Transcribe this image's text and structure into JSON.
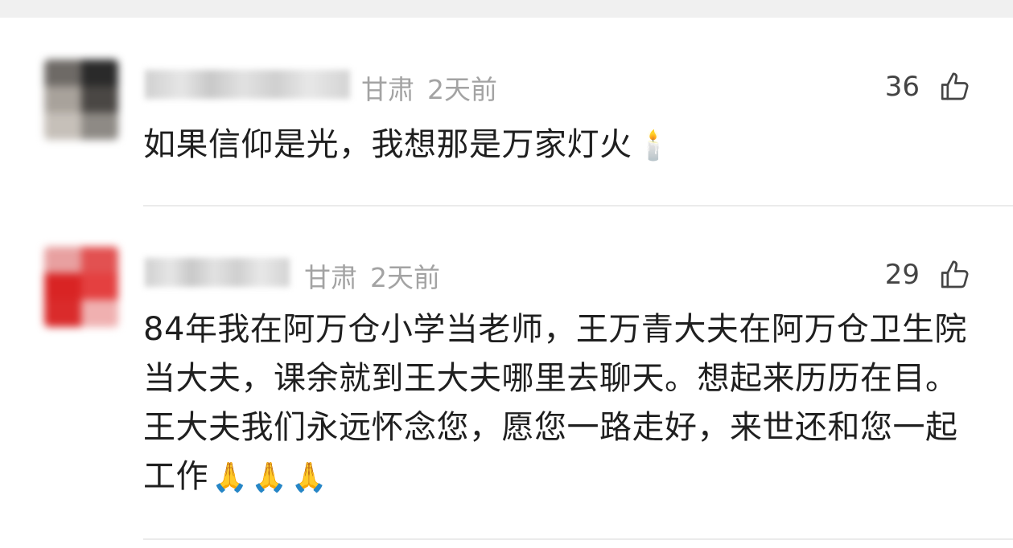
{
  "comments": [
    {
      "location": "甘肃",
      "time": "2天前",
      "likes": "36",
      "text": "如果信仰是光，我想那是万家灯火",
      "emoji": [
        "🕯️"
      ]
    },
    {
      "location": "甘肃",
      "time": "2天前",
      "likes": "29",
      "text": "84年我在阿万仓小学当老师，王万青大夫在阿万仓卫生院当大夫，课余就到王大夫哪里去聊天。想起来历历在目。王大夫我们永远怀念您，愿您一路走好，来世还和您一起工作",
      "emoji": [
        "🙏",
        "🙏",
        "🙏"
      ]
    }
  ],
  "icons": {
    "like": "thumbs-up-outline-icon"
  },
  "colors": {
    "meta_text": "#a3a3a3",
    "body_text": "#1f1f1f",
    "like_count": "#444444",
    "divider": "#ebebeb"
  }
}
